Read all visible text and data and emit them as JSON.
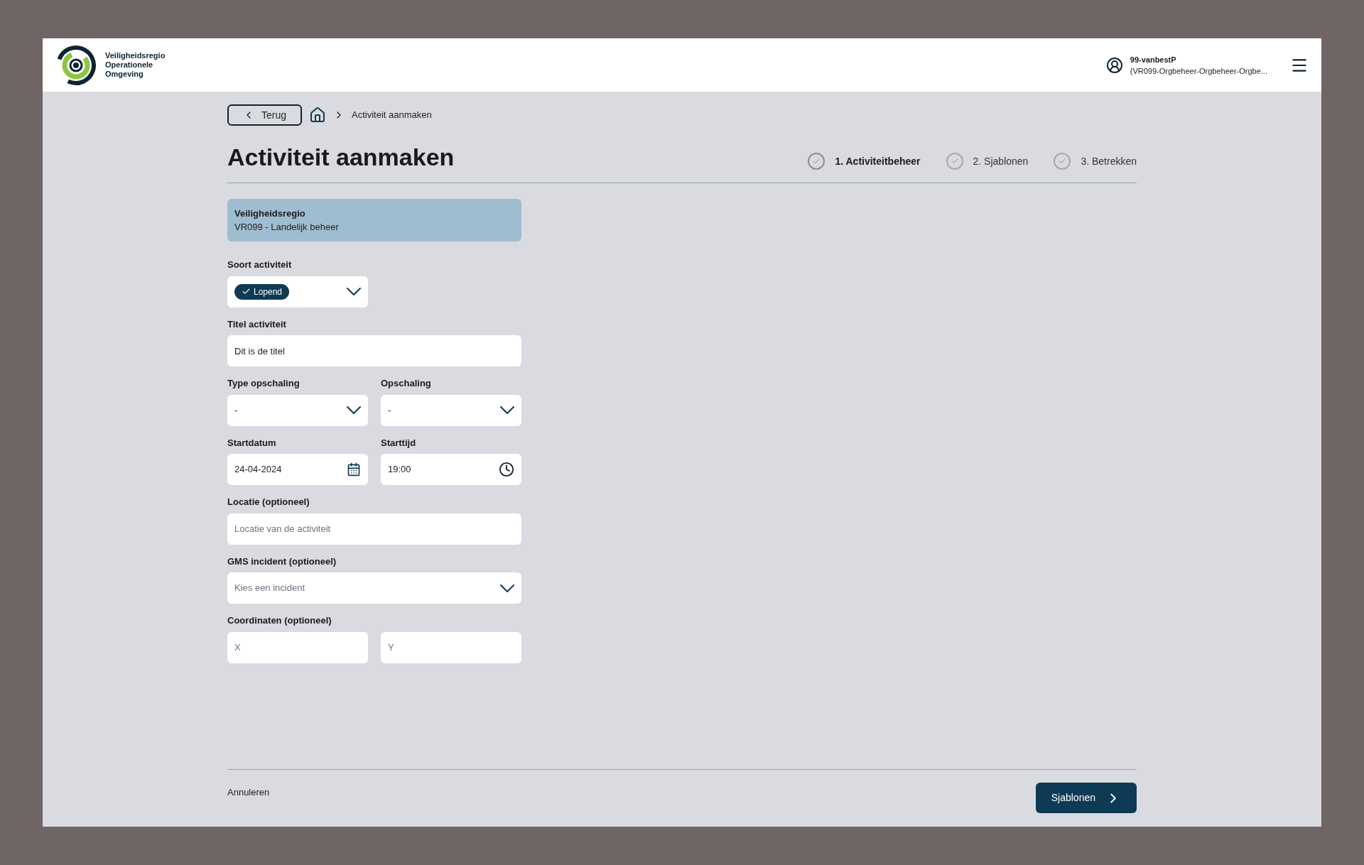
{
  "header": {
    "logo_lines": [
      "Veiligheidsregio",
      "Operationele",
      "Omgeving"
    ],
    "user_name": "99-vanbestP",
    "user_org": "(VR099-Orgbeheer-Orgbeheer-Orgbe..."
  },
  "breadcrumb": {
    "back": "Terug",
    "current": "Activiteit aanmaken"
  },
  "title": "Activiteit aanmaken",
  "steps": [
    {
      "label": "1. Activiteitbeheer",
      "selected": true
    },
    {
      "label": "2. Sjablonen",
      "selected": false
    },
    {
      "label": "3. Betrekken",
      "selected": false
    }
  ],
  "region": {
    "label": "Veiligheidsregio",
    "value": "VR099 - Landelijk beheer"
  },
  "rows": [
    {
      "fields": [
        {
          "kind": "tag-select",
          "label": "Soort activiteit",
          "value": "Lopend"
        }
      ]
    },
    {
      "fields": [
        {
          "kind": "text",
          "label": "Titel activiteit",
          "value": "Dit is de titel"
        }
      ]
    },
    {
      "fields": [
        {
          "kind": "select",
          "label": "Type opschaling",
          "value": "-"
        },
        {
          "kind": "select",
          "label": "Opschaling",
          "value": "-"
        }
      ]
    },
    {
      "fields": [
        {
          "kind": "date",
          "label": "Startdatum",
          "value": "24-04-2024"
        },
        {
          "kind": "time",
          "label": "Starttijd",
          "value": "19:00"
        }
      ]
    },
    {
      "fields": [
        {
          "kind": "text",
          "label": "Locatie (optioneel)",
          "placeholder": "Locatie van de activiteit"
        }
      ]
    },
    {
      "fields": [
        {
          "kind": "select",
          "label": "GMS incident (optioneel)",
          "placeholder": "Kies een incident"
        }
      ]
    },
    {
      "label": "Coordinaten (optioneel)",
      "fields": [
        {
          "kind": "text",
          "placeholder": "X"
        },
        {
          "kind": "text",
          "placeholder": "Y"
        }
      ]
    }
  ],
  "footer": {
    "cancel": "Annuleren",
    "next": "Sjablonen"
  }
}
